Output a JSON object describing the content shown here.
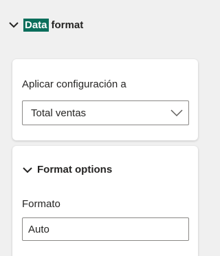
{
  "section": {
    "title_highlight": "Data",
    "title_rest": "format",
    "chevron_icon": "chevron-down-icon"
  },
  "apply_card": {
    "label": "Aplicar configuración a",
    "dropdown": {
      "selected": "Total ventas",
      "caret_icon": "chevron-down-icon"
    }
  },
  "format_options": {
    "title": "Format options",
    "chevron_icon": "chevron-down-icon",
    "format_field": {
      "label": "Formato",
      "value": "Auto"
    }
  },
  "colors": {
    "highlight": "#0b6e5b",
    "panel_bg": "#f0f0f0",
    "card_bg": "#ffffff",
    "border": "#8a8886"
  }
}
